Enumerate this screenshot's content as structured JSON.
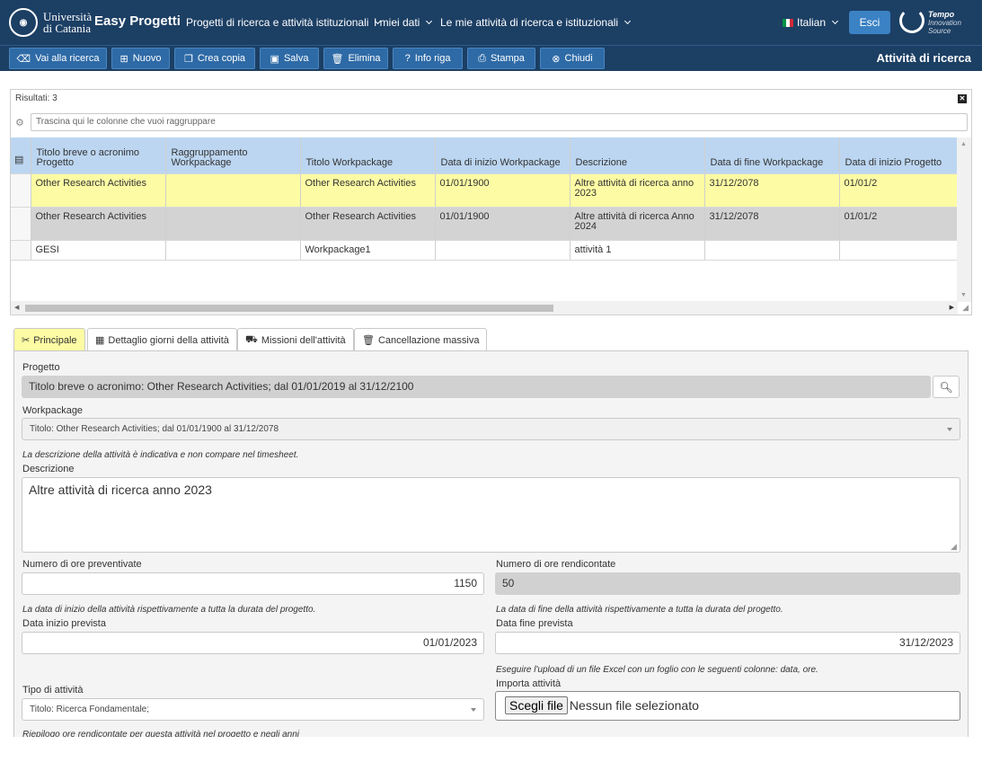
{
  "header": {
    "university": [
      "Università",
      "di Catania"
    ],
    "app_name": "Easy Progetti",
    "menus": [
      "Progetti di ricerca e attività istituzionali",
      "I miei dati",
      "Le mie attività di ricerca e istituzionali"
    ],
    "language": "Italian",
    "logout": "Esci",
    "tempo_brand": "Tempo",
    "tempo_sub": [
      "Innovation",
      "Source"
    ]
  },
  "toolbar": {
    "buttons": [
      {
        "label": "Vai alla ricerca",
        "icon": "eraser-icon",
        "glyph": "⌫"
      },
      {
        "label": "Nuovo",
        "icon": "plus-square-icon",
        "glyph": "⊞"
      },
      {
        "label": "Crea copia",
        "icon": "copy-icon",
        "glyph": "❐"
      },
      {
        "label": "Salva",
        "icon": "save-icon",
        "glyph": "▣"
      },
      {
        "label": "Elimina",
        "icon": "trash-icon",
        "glyph": "🗑"
      },
      {
        "label": "Info riga",
        "icon": "question-icon",
        "glyph": "?"
      },
      {
        "label": "Stampa",
        "icon": "print-icon",
        "glyph": "⎙"
      },
      {
        "label": "Chiudi",
        "icon": "close-circle-icon",
        "glyph": "⊗"
      }
    ],
    "page_title": "Attività di ricerca"
  },
  "grid": {
    "results_label": "Risultati: 3",
    "group_placeholder": "Trascina qui le colonne che vuoi raggruppare",
    "columns": [
      "Titolo breve o acronimo Progetto",
      "Raggruppamento Workpackage",
      "Titolo Workpackage",
      "Data di inizio Workpackage",
      "Descrizione",
      "Data di fine Workpackage",
      "Data di inizio Progetto"
    ],
    "rows": [
      [
        "Other Research Activities",
        "",
        "Other Research Activities",
        "01/01/1900",
        "Altre attività di ricerca anno 2023",
        "31/12/2078",
        "01/01/2"
      ],
      [
        "Other Research Activities",
        "",
        "Other Research Activities",
        "01/01/1900",
        "Altre attività di ricerca Anno 2024",
        "31/12/2078",
        "01/01/2"
      ],
      [
        "GESI",
        "",
        "Workpackage1",
        "",
        "attività 1",
        "",
        ""
      ]
    ]
  },
  "tabs": [
    {
      "label": "Principale",
      "icon": "tools-icon",
      "glyph": "✂"
    },
    {
      "label": "Dettaglio giorni della attività",
      "icon": "calendar-icon",
      "glyph": "▦"
    },
    {
      "label": "Missioni dell'attività",
      "icon": "car-icon",
      "glyph": "⛟"
    },
    {
      "label": "Cancellazione massiva",
      "icon": "trash-icon",
      "glyph": "🗑"
    }
  ],
  "form": {
    "progetto_label": "Progetto",
    "progetto_value": "Titolo breve o acronimo: Other Research Activities;  dal 01/01/2019 al 31/12/2100",
    "workpackage_label": "Workpackage",
    "workpackage_value": "Titolo: Other Research Activities; dal 01/01/1900 al 31/12/2078",
    "descr_hint": "La descrizione della attività è indicativa e non compare nel timesheet.",
    "descr_label": "Descrizione",
    "descr_value": "Altre attività di ricerca anno 2023",
    "ore_prev_label": "Numero di ore preventivate",
    "ore_prev_value": "1150",
    "ore_rend_label": "Numero di ore rendicontate",
    "ore_rend_value": "50",
    "start_hint": "La data di inizio della attività rispettivamente a tutta la durata del progetto.",
    "end_hint": "La data di fine della attività rispettivamente a tutta la durata del progetto.",
    "start_label": "Data inizio prevista",
    "start_value": "01/01/2023",
    "end_label": "Data fine prevista",
    "end_value": "31/12/2023",
    "upload_hint": "Eseguire l'upload di un file Excel con un foglio con le seguenti colonne: data, ore.",
    "tipo_label": "Tipo di attività",
    "tipo_value": "Titolo: Ricerca Fondamentale;",
    "import_label": "Importa attività",
    "file_button": "Scegli file",
    "file_none": "Nessun file selezionato",
    "riepilogo": "Riepilogo ore rendicontate per questa attività nel progetto e negli anni"
  }
}
